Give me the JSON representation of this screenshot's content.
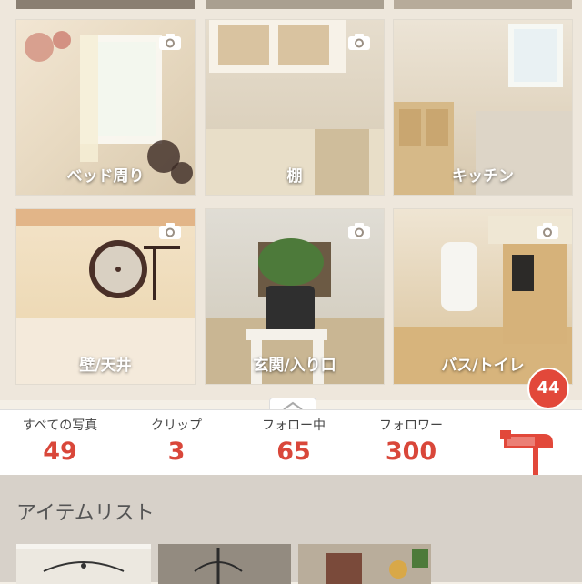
{
  "tiles": [
    {
      "label": "ベッド周り"
    },
    {
      "label": "棚"
    },
    {
      "label": "キッチン"
    },
    {
      "label": "壁/天井"
    },
    {
      "label": "玄関/入り口"
    },
    {
      "label": "バス/トイレ"
    }
  ],
  "stats": [
    {
      "label": "すべての写真",
      "value": "49"
    },
    {
      "label": "クリップ",
      "value": "3"
    },
    {
      "label": "フォロー中",
      "value": "65"
    },
    {
      "label": "フォロワー",
      "value": "300"
    }
  ],
  "mailbox": {
    "badge": "44"
  },
  "items_section": {
    "title": "アイテムリスト"
  },
  "colors": {
    "accent": "#d9473a",
    "badge": "#e2483a"
  },
  "icons": [
    "camera-icon",
    "chevron-up-icon",
    "mailbox-icon"
  ]
}
